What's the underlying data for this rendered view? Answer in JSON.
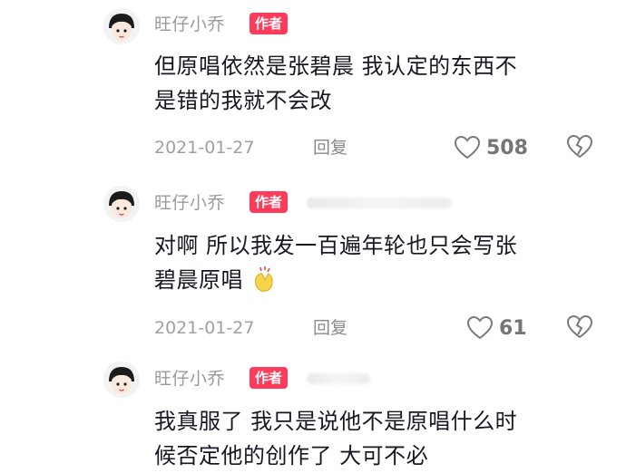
{
  "comments": [
    {
      "username": "旺仔小乔",
      "badge": "作者",
      "line1": "但原唱依然是张碧晨 我认定的东西不",
      "line2": "是错的我就不会改",
      "date": "2021-01-27",
      "reply": "回复",
      "likes": "508"
    },
    {
      "username": "旺仔小乔",
      "badge": "作者",
      "line1": "对啊 所以我发一百遍年轮也只会写张",
      "line2": "碧晨原唱",
      "date": "2021-01-27",
      "reply": "回复",
      "likes": "61"
    },
    {
      "username": "旺仔小乔",
      "badge": "作者",
      "line1": "我真服了 我只是说他不是原唱什么时",
      "line2": "候否定他的创作了 大可不必"
    }
  ],
  "icons": {
    "like": "heart-outline-icon",
    "dislike": "broken-heart-icon",
    "emoji": "clapping-hands-emoji"
  },
  "colors": {
    "badge": "#ff3b5c",
    "text": "#161823",
    "muted": "#a0a0a0"
  }
}
